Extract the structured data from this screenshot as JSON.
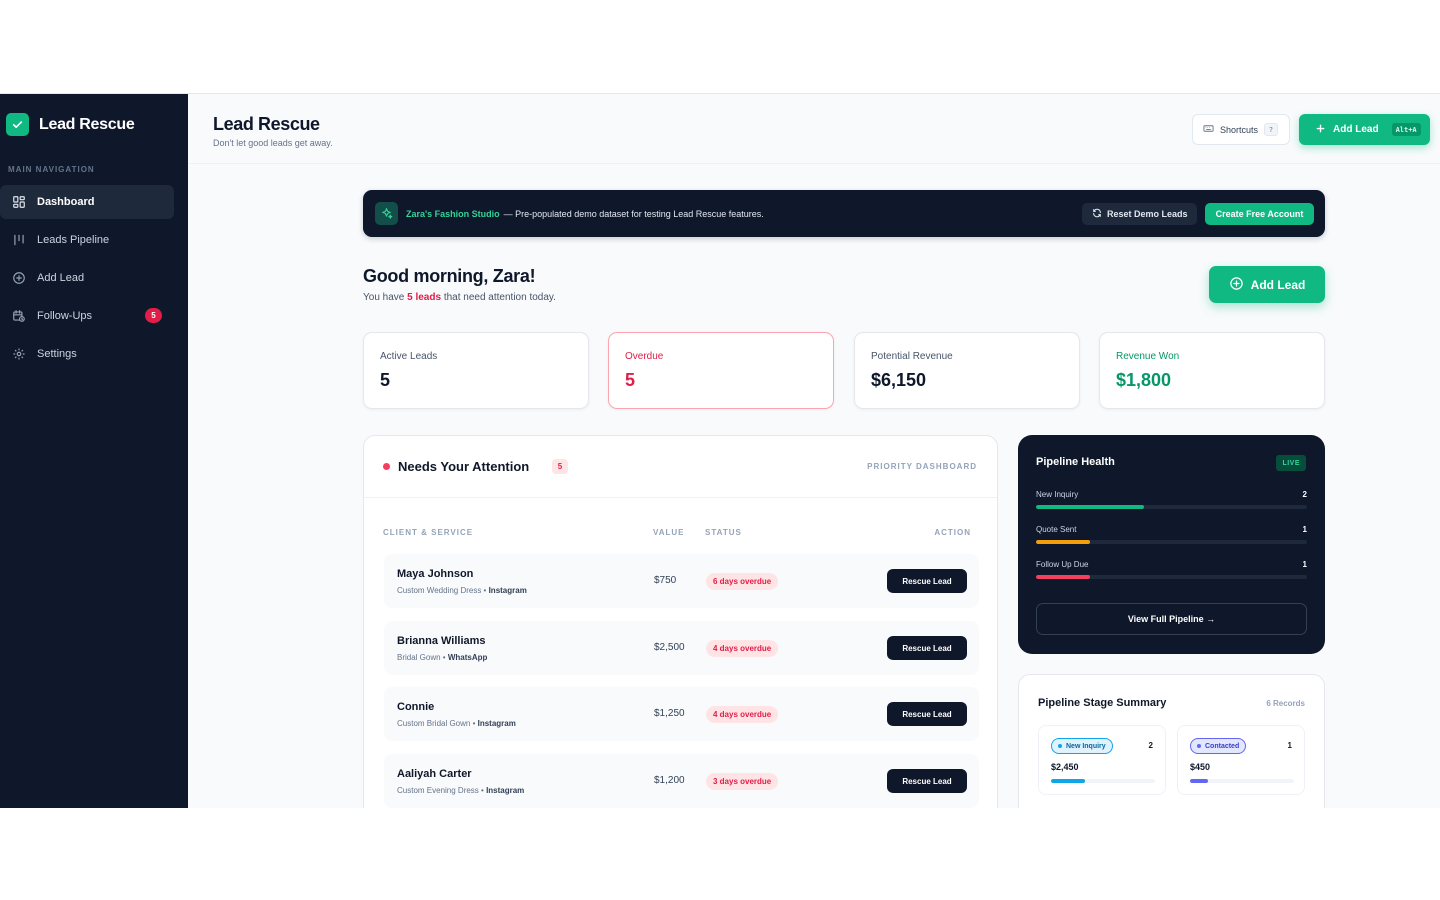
{
  "sidebar": {
    "brand": "Lead Rescue",
    "nav_heading": "MAIN NAVIGATION",
    "items": [
      {
        "label": "Dashboard",
        "icon": "grid-icon"
      },
      {
        "label": "Leads Pipeline",
        "icon": "columns-icon"
      },
      {
        "label": "Add Lead",
        "icon": "plus-circle-icon"
      },
      {
        "label": "Follow-Ups",
        "icon": "calendar-clock-icon",
        "badge": "5"
      },
      {
        "label": "Settings",
        "icon": "gear-icon"
      }
    ]
  },
  "header": {
    "title": "Lead Rescue",
    "subtitle": "Don't let good leads get away.",
    "shortcuts_label": "Shortcuts",
    "shortcuts_key": "?",
    "add_lead_label": "Add Lead",
    "add_lead_key": "Alt+A"
  },
  "banner": {
    "studio": "Zara's Fashion Studio",
    "text": "— Pre-populated demo dataset for testing Lead Rescue features.",
    "reset_label": "Reset Demo Leads",
    "create_label": "Create Free Account"
  },
  "greeting": {
    "title": "Good morning, Zara!",
    "prefix": "You have",
    "highlight": "5 leads",
    "suffix": "that need attention today.",
    "add_lead_label": "Add Lead"
  },
  "stats": [
    {
      "label": "Active Leads",
      "value": "5"
    },
    {
      "label": "Overdue",
      "value": "5"
    },
    {
      "label": "Potential Revenue",
      "value": "$6,150"
    },
    {
      "label": "Revenue Won",
      "value": "$1,800"
    }
  ],
  "attention": {
    "title": "Needs Your Attention",
    "count": "5",
    "tag": "PRIORITY DASHBOARD",
    "columns": [
      "CLIENT & SERVICE",
      "VALUE",
      "STATUS",
      "ACTION"
    ],
    "rows": [
      {
        "name": "Maya Johnson",
        "service": "Custom Wedding Dress",
        "channel": "Instagram",
        "value": "$750",
        "status": "6 days overdue",
        "action": "Rescue Lead"
      },
      {
        "name": "Brianna Williams",
        "service": "Bridal Gown",
        "channel": "WhatsApp",
        "value": "$2,500",
        "status": "4 days overdue",
        "action": "Rescue Lead"
      },
      {
        "name": "Connie",
        "service": "Custom Bridal Gown",
        "channel": "Instagram",
        "value": "$1,250",
        "status": "4 days overdue",
        "action": "Rescue Lead"
      },
      {
        "name": "Aaliyah Carter",
        "service": "Custom Evening Dress",
        "channel": "Instagram",
        "value": "$1,200",
        "status": "3 days overdue",
        "action": "Rescue Lead"
      }
    ]
  },
  "health": {
    "title": "Pipeline Health",
    "live": "LIVE",
    "stages": [
      {
        "label": "New Inquiry",
        "count": "2",
        "fraction": 0.4,
        "color": "#10b981"
      },
      {
        "label": "Quote Sent",
        "count": "1",
        "fraction": 0.2,
        "color": "#f59e0b"
      },
      {
        "label": "Follow Up Due",
        "count": "1",
        "fraction": 0.2,
        "color": "#f43f5e"
      }
    ],
    "view_label": "View Full Pipeline →"
  },
  "stage_summary": {
    "title": "Pipeline Stage Summary",
    "records": "6 Records",
    "cards": [
      {
        "label": "New Inquiry",
        "count": "2",
        "amount": "$2,450",
        "fraction": 0.33,
        "color": "#0ea5e9",
        "bg": "#e0f2fe",
        "text": "#0369a1"
      },
      {
        "label": "Contacted",
        "count": "1",
        "amount": "$450",
        "fraction": 0.17,
        "color": "#6366f1",
        "bg": "#e0e7ff",
        "text": "#4338ca"
      }
    ]
  }
}
